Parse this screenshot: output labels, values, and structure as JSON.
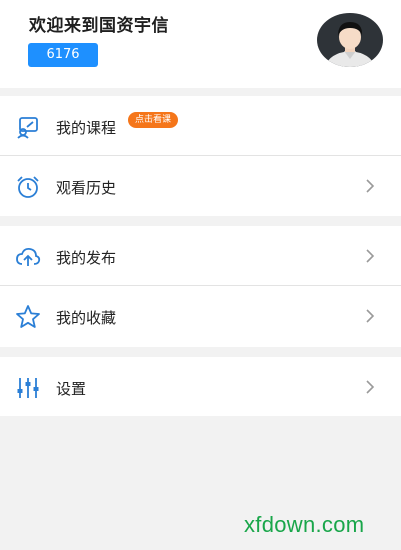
{
  "header": {
    "welcome_text": "欢迎来到国资宇信",
    "user_id": "6176"
  },
  "menu": {
    "my_courses": {
      "label": "我的课程",
      "badge": "点击看课"
    },
    "watch_history": {
      "label": "观看历史"
    },
    "my_posts": {
      "label": "我的发布"
    },
    "my_favorites": {
      "label": "我的收藏"
    },
    "settings": {
      "label": "设置"
    }
  },
  "watermark": "xfdown.com",
  "colors": {
    "accent_blue": "#1e90ff",
    "badge_orange": "#f5761a",
    "icon_blue": "#2b7fd6",
    "watermark_green": "#19a64a"
  }
}
